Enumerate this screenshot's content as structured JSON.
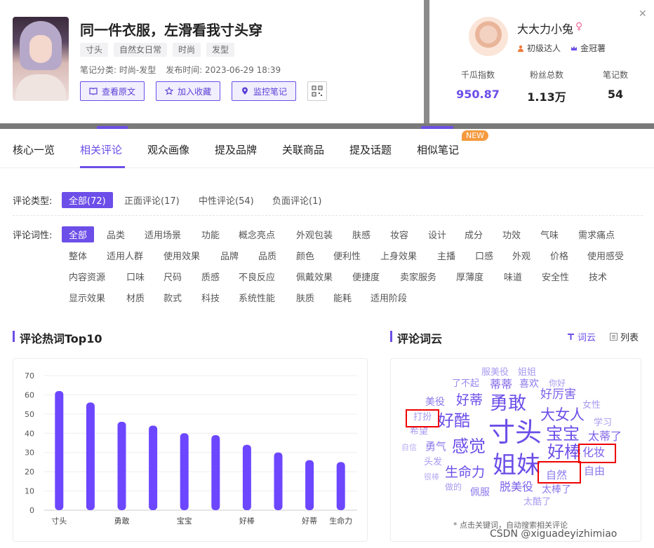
{
  "note": {
    "title": "同一件衣服，左滑看我寸头穿",
    "tags": [
      "寸头",
      "自然女日常",
      "时尚",
      "发型"
    ],
    "category": "笔记分类: 时尚-发型",
    "publish_time": "发布时间: 2023-06-29 18:39",
    "actions": [
      "查看原文",
      "加入收藏",
      "监控笔记"
    ]
  },
  "author": {
    "name": "大大力小兔",
    "badges": [
      "初级达人",
      "金冠薯"
    ],
    "stats": [
      {
        "label": "千瓜指数",
        "value": "950.87"
      },
      {
        "label": "粉丝总数",
        "value": "1.13万"
      },
      {
        "label": "笔记数",
        "value": "54"
      }
    ]
  },
  "tabs": [
    "核心一览",
    "相关评论",
    "观众画像",
    "提及品牌",
    "关联商品",
    "提及话题",
    "相似笔记"
  ],
  "new_badge": "NEW",
  "filters": {
    "type_label": "评论类型:",
    "types": [
      "全部(72)",
      "正面评论(17)",
      "中性评论(54)",
      "负面评论(1)"
    ],
    "attr_label": "评论词性:",
    "attrs": [
      [
        "全部",
        "品类",
        "适用场景",
        "功能",
        "概念亮点",
        "外观包装",
        "肤感",
        "妆容",
        "设计",
        "成分",
        "功效",
        "气味",
        "需求痛点"
      ],
      [
        "整体",
        "适用人群",
        "使用效果",
        "品牌",
        "品质",
        "颜色",
        "便利性",
        "上身效果",
        "主播",
        "口感",
        "外观",
        "价格",
        "使用感受"
      ],
      [
        "内容资源",
        "口味",
        "尺码",
        "质感",
        "不良反应",
        "佩戴效果",
        "便捷度",
        "卖家服务",
        "厚薄度",
        "味道",
        "安全性",
        "技术"
      ],
      [
        "显示效果",
        "材质",
        "款式",
        "科技",
        "系统性能",
        "肤质",
        "能耗",
        "适用阶段"
      ]
    ]
  },
  "sections": {
    "hot_words_title": "评论热词Top10",
    "cloud_title": "评论词云",
    "view_cloud": "词云",
    "view_list": "列表"
  },
  "chart_data": {
    "type": "bar",
    "categories": [
      "寸头",
      "",
      "勇敢",
      "",
      "宝宝",
      "",
      "好棒",
      "",
      "好蒂",
      "生命力"
    ],
    "values": [
      62,
      56,
      46,
      44,
      40,
      39,
      34,
      30,
      26,
      25
    ],
    "ylim": [
      0,
      70
    ],
    "yticks": [
      0,
      10,
      20,
      30,
      40,
      50,
      60,
      70
    ],
    "grid": true,
    "bar_color": "#6c47ff"
  },
  "cloud": {
    "words": [
      {
        "text": "服美役",
        "size": 13,
        "color": "#a99af0"
      },
      {
        "text": "姐姐",
        "size": 13,
        "color": "#a99af0"
      },
      {
        "text": "了不起",
        "size": 13,
        "color": "#9a86ee"
      },
      {
        "text": "蒂蒂",
        "size": 16,
        "color": "#7d62ea"
      },
      {
        "text": "喜欢",
        "size": 14,
        "color": "#8d78ec"
      },
      {
        "text": "你好",
        "size": 12,
        "color": "#a99af0"
      },
      {
        "text": "美役",
        "size": 14,
        "color": "#8d78ec"
      },
      {
        "text": "好蒂",
        "size": 19,
        "color": "#6c4ee8"
      },
      {
        "text": "勇敢",
        "size": 26,
        "color": "#6c4ee8"
      },
      {
        "text": "好厉害",
        "size": 17,
        "color": "#7d62ea"
      },
      {
        "text": "女性",
        "size": 13,
        "color": "#a99af0"
      },
      {
        "text": "打扮",
        "size": 13,
        "color": "#a99af0"
      },
      {
        "text": "好酷",
        "size": 23,
        "color": "#6c4ee8"
      },
      {
        "text": "大女人",
        "size": 21,
        "color": "#6c4ee8"
      },
      {
        "text": "学习",
        "size": 13,
        "color": "#a99af0"
      },
      {
        "text": "希望",
        "size": 13,
        "color": "#a99af0"
      },
      {
        "text": "寸头",
        "size": 38,
        "color": "#6c4ee8"
      },
      {
        "text": "宝宝",
        "size": 24,
        "color": "#6c4ee8"
      },
      {
        "text": "太蒂了",
        "size": 16,
        "color": "#7d62ea"
      },
      {
        "text": "自信",
        "size": 11,
        "color": "#b8acf2"
      },
      {
        "text": "勇气",
        "size": 15,
        "color": "#8d78ec"
      },
      {
        "text": "感觉",
        "size": 24,
        "color": "#6c4ee8"
      },
      {
        "text": "好棒",
        "size": 24,
        "color": "#6c4ee8"
      },
      {
        "text": "化妆",
        "size": 16,
        "color": "#7d62ea"
      },
      {
        "text": "头发",
        "size": 13,
        "color": "#a99af0"
      },
      {
        "text": "姐妹",
        "size": 34,
        "color": "#6c4ee8"
      },
      {
        "text": "生命力",
        "size": 19,
        "color": "#6c4ee8"
      },
      {
        "text": "自由",
        "size": 15,
        "color": "#8d78ec"
      },
      {
        "text": "很棒",
        "size": 11,
        "color": "#b8acf2"
      },
      {
        "text": "自然",
        "size": 15,
        "color": "#8d78ec"
      },
      {
        "text": "做的",
        "size": 12,
        "color": "#a99af0"
      },
      {
        "text": "脱美役",
        "size": 16,
        "color": "#7d62ea"
      },
      {
        "text": "佩服",
        "size": 14,
        "color": "#8d78ec"
      },
      {
        "text": "太棒了",
        "size": 14,
        "color": "#8d78ec"
      },
      {
        "text": "太酷了",
        "size": 13,
        "color": "#a99af0"
      }
    ],
    "note": "* 点击关键词，自动搜索相关评论"
  },
  "watermark": "CSDN @xiguadeyizhimiao"
}
